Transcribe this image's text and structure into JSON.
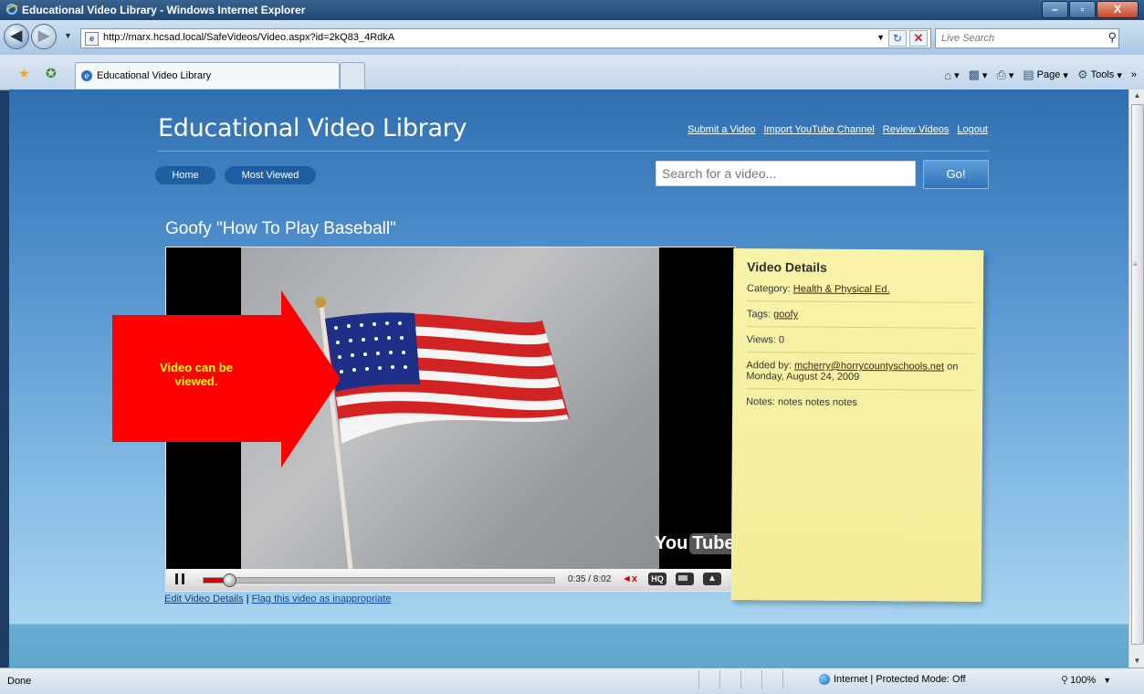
{
  "window": {
    "title": "Educational Video Library - Windows Internet Explorer",
    "minimize_glyph": "–",
    "maximize_glyph": "▫",
    "close_glyph": "X"
  },
  "address_bar": {
    "url": "http://marx.hcsad.local/SafeVideos/Video.aspx?id=2kQ83_4RdkA",
    "search_placeholder": "Live Search"
  },
  "tab": {
    "label": "Educational Video Library"
  },
  "command_bar": {
    "page_label": "Page",
    "tools_label": "Tools"
  },
  "site": {
    "title": "Educational Video Library",
    "top_links": [
      "Submit a Video",
      "Import YouTube Channel",
      "Review Videos",
      "Logout"
    ],
    "nav": {
      "home": "Home",
      "most_viewed": "Most Viewed"
    },
    "search_placeholder": "Search for a video...",
    "go_label": "Go!"
  },
  "video": {
    "title": "Goofy \"How To Play Baseball\"",
    "time": "0:35 / 8:02",
    "progress": 0.0726,
    "hq_label": "HQ",
    "logo_you": "You",
    "logo_tube": "Tube",
    "edit_link": "Edit Video Details",
    "separator": "|",
    "flag_link": "Flag this video as inappropriate"
  },
  "callout": {
    "text": "Video can be viewed."
  },
  "details": {
    "heading": "Video Details",
    "category_label": "Category:",
    "category_value": "Health & Physical Ed.",
    "tags_label": "Tags:",
    "tags_value": "goofy",
    "views": "Views: 0",
    "added_label": "Added by:",
    "added_by": "mcherry@horrycountyschools.net",
    "added_on": "on Monday, August 24, 2009",
    "notes": "Notes: notes notes notes"
  },
  "status_bar": {
    "status": "Done",
    "zone": "Internet | Protected Mode: Off",
    "zoom": "100%"
  },
  "colors": {
    "callout_arrow": "#ff0000",
    "callout_text": "#ffff00",
    "note_background": "#f6ef9f",
    "page_top": "#2f6fb0"
  }
}
